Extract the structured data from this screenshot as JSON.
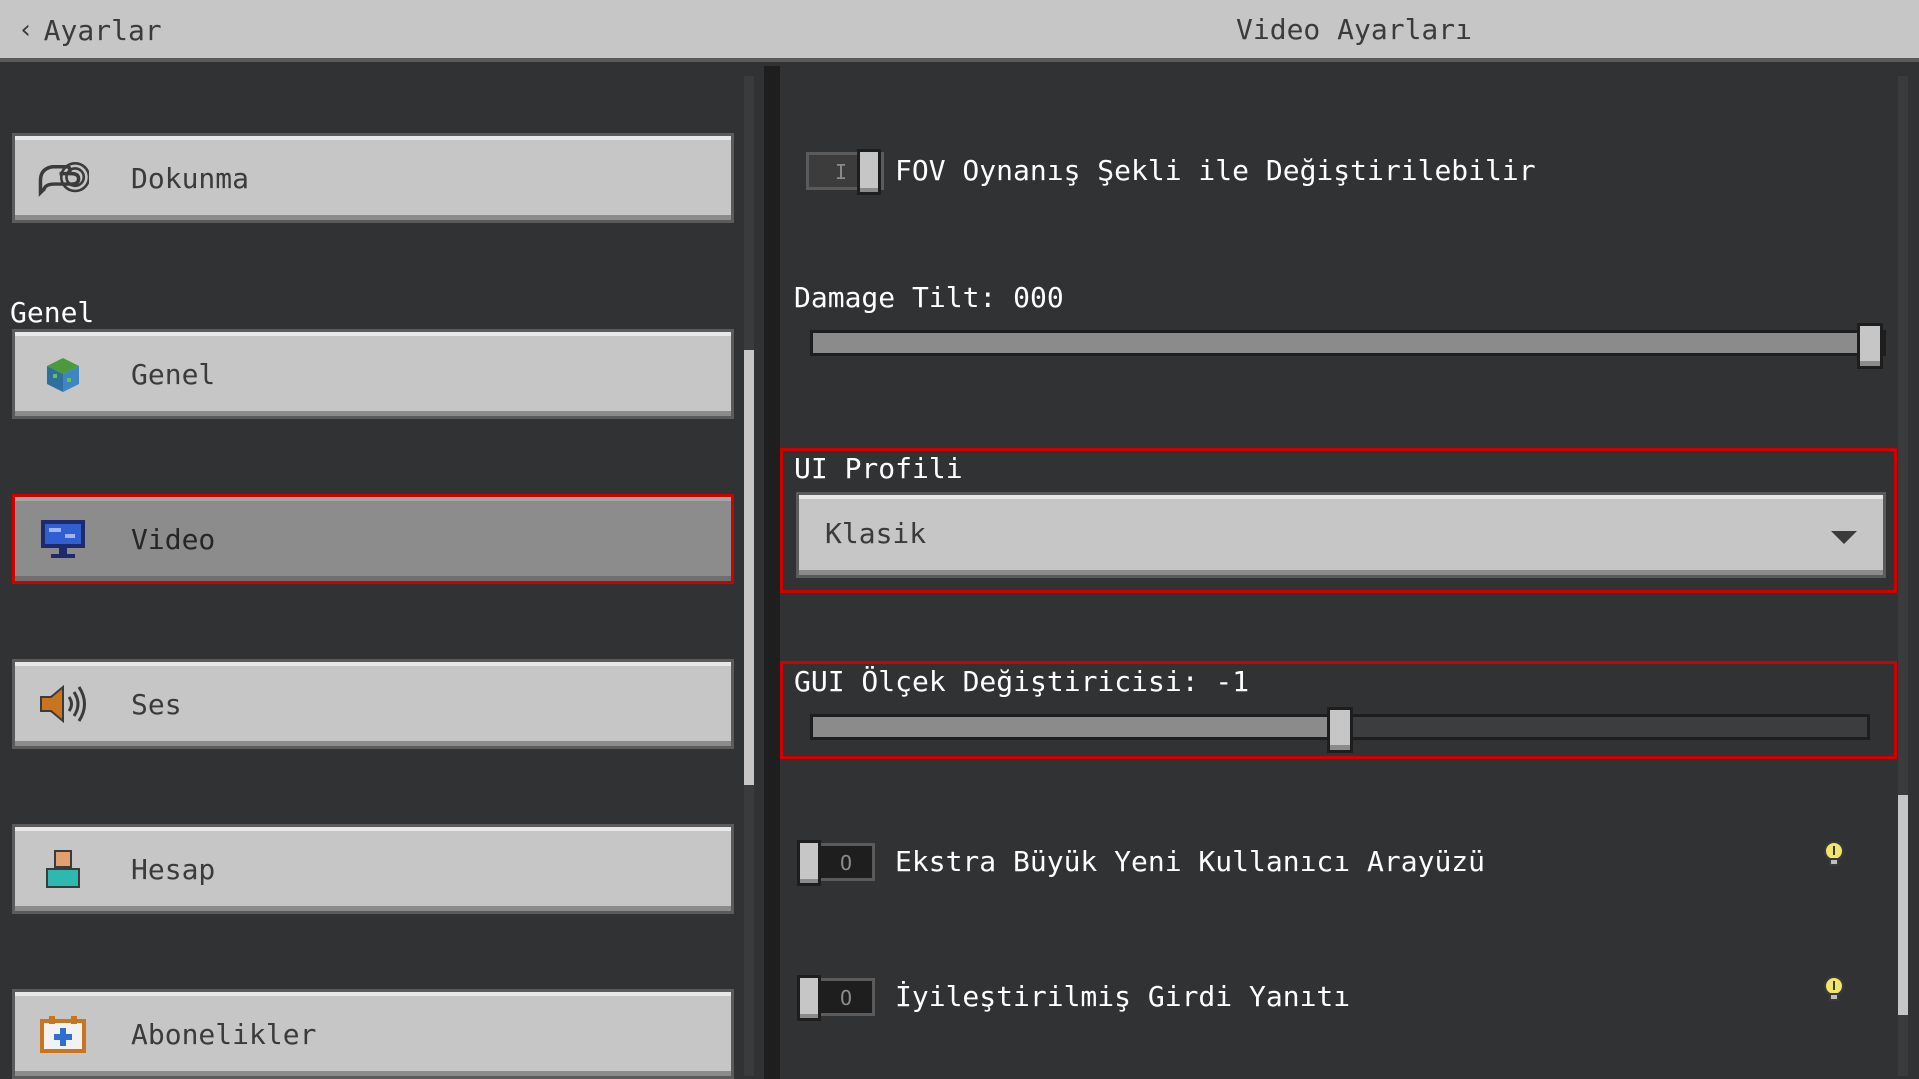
{
  "header": {
    "back_label": "Ayarlar",
    "title": "Video Ayarları"
  },
  "sidebar": {
    "section_title": "Genel",
    "items": [
      {
        "label": "Dokunma",
        "icon": "touch-hand-icon"
      },
      {
        "label": "Genel",
        "icon": "cube-icon"
      },
      {
        "label": "Video",
        "icon": "monitor-icon",
        "active": true
      },
      {
        "label": "Ses",
        "icon": "speaker-icon"
      },
      {
        "label": "Hesap",
        "icon": "account-icon"
      },
      {
        "label": "Abonelikler",
        "icon": "subscriptions-icon"
      }
    ]
  },
  "settings": {
    "fov_toggle": {
      "label": "FOV Oynanış Şekli ile Değiştirilebilir",
      "on": true,
      "mark": "I"
    },
    "damage_tilt": {
      "label": "Damage Tilt: 000",
      "value_fraction": 1.0
    },
    "ui_profile": {
      "label": "UI Profili",
      "selected": "Klasik"
    },
    "gui_scale": {
      "label": "GUI Ölçek Değiştiricisi: -1",
      "value_fraction": 0.5
    },
    "extra_large_ui": {
      "label": "Ekstra Büyük Yeni Kullanıcı Arayüzü",
      "on": false,
      "mark": "O"
    },
    "improved_input": {
      "label": "İyileştirilmiş Girdi Yanıtı",
      "on": false,
      "mark": "O"
    }
  },
  "colors": {
    "accent_highlight": "#d10000",
    "button_face": "#c6c6c6",
    "background": "#313233"
  }
}
